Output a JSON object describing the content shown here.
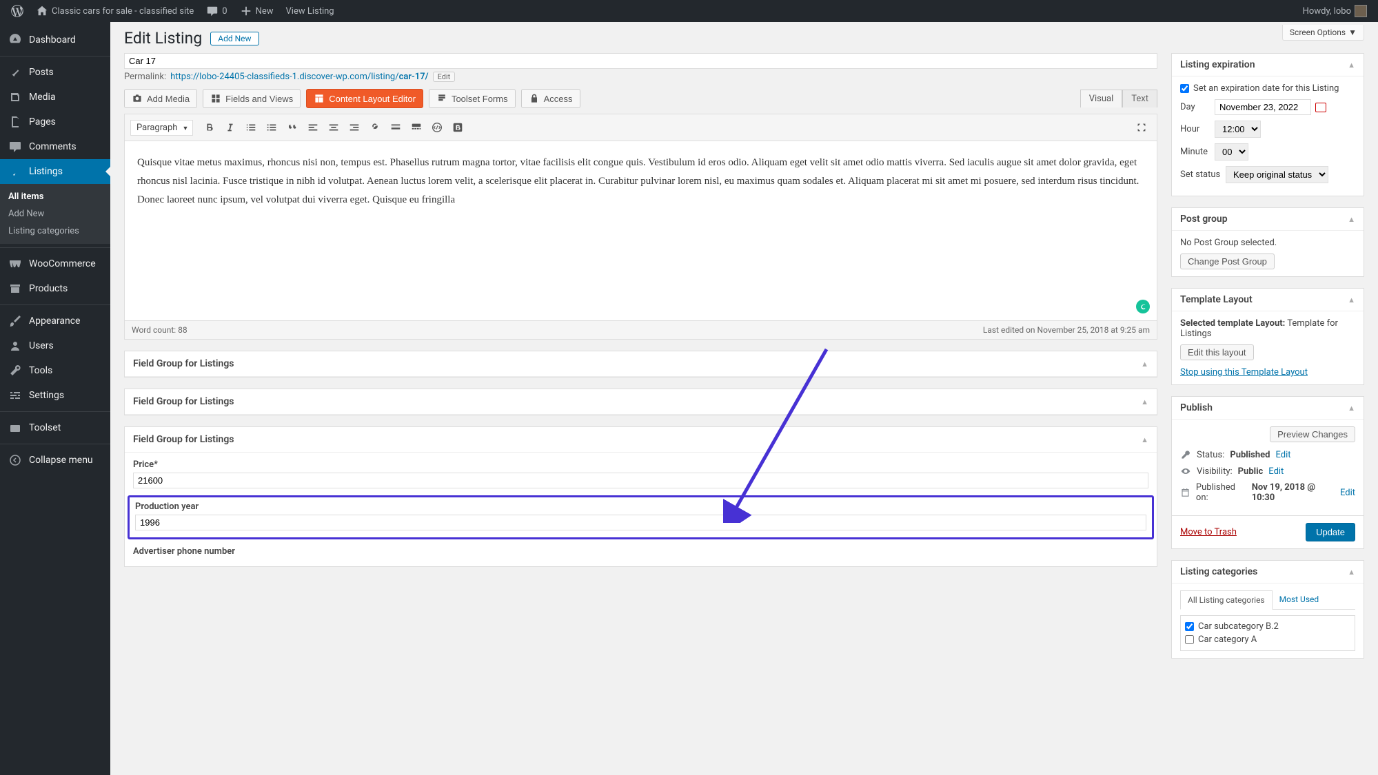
{
  "adminbar": {
    "site_name": "Classic cars for sale - classified site",
    "comments_count": "0",
    "new_label": "New",
    "view_listing": "View Listing",
    "howdy": "Howdy, lobo"
  },
  "sidebar": {
    "dashboard": "Dashboard",
    "posts": "Posts",
    "media": "Media",
    "pages": "Pages",
    "comments": "Comments",
    "listings": "Listings",
    "sub_all": "All items",
    "sub_add": "Add New",
    "sub_cats": "Listing categories",
    "woocommerce": "WooCommerce",
    "products": "Products",
    "appearance": "Appearance",
    "users": "Users",
    "tools": "Tools",
    "settings": "Settings",
    "toolset": "Toolset",
    "collapse": "Collapse menu"
  },
  "header": {
    "title": "Edit Listing",
    "add_new": "Add New",
    "screen_options": "Screen Options"
  },
  "title_input": "Car 17",
  "permalink": {
    "label": "Permalink:",
    "base": "https://lobo-24405-classifieds-1.discover-wp.com/listing/",
    "slug": "car-17/",
    "edit": "Edit"
  },
  "editor_buttons": {
    "add_media": "Add Media",
    "fields_views": "Fields and Views",
    "content_layout": "Content Layout Editor",
    "toolset_forms": "Toolset Forms",
    "access": "Access",
    "tab_visual": "Visual",
    "tab_text": "Text",
    "paragraph": "Paragraph"
  },
  "editor_body": "Quisque vitae metus maximus, rhoncus nisi non, tempus est. Phasellus rutrum magna tortor, vitae facilisis elit congue quis. Vestibulum id eros odio. Aliquam eget velit sit amet odio mattis viverra. Sed iaculis augue sit amet dolor gravida, eget rhoncus nisl lacinia. Fusce tristique in nibh id volutpat. Aenean luctus lorem velit, a scelerisque elit placerat in. Curabitur pulvinar lorem nisl, eu maximus quam sodales et. Aliquam placerat mi sit amet mi posuere, sed interdum risus tincidunt. Donec laoreet nunc ipsum, vel volutpat dui viverra eget. Quisque eu fringilla",
  "editor_footer": {
    "wordcount": "Word count: 88",
    "last_edit": "Last edited on November 25, 2018 at 9:25 am"
  },
  "metabox": {
    "field_group": "Field Group for Listings",
    "price_label": "Price*",
    "price_value": "21600",
    "year_label": "Production year",
    "year_value": "1996",
    "phone_label": "Advertiser phone number"
  },
  "side": {
    "expiration": {
      "title": "Listing expiration",
      "set_label": "Set an expiration date for this Listing",
      "day_label": "Day",
      "day_value": "November 23, 2022",
      "hour_label": "Hour",
      "hour_value": "12:00",
      "minute_label": "Minute",
      "minute_value": "00",
      "status_label": "Set status",
      "status_value": "Keep original status"
    },
    "postgroup": {
      "title": "Post group",
      "none": "No Post Group selected.",
      "change": "Change Post Group"
    },
    "template": {
      "title": "Template Layout",
      "selected_label": "Selected template Layout:",
      "selected_value": "Template for Listings",
      "edit": "Edit this layout",
      "stop": "Stop using this Template Layout"
    },
    "publish": {
      "title": "Publish",
      "preview": "Preview Changes",
      "status_label": "Status:",
      "status_value": "Published",
      "visibility_label": "Visibility:",
      "visibility_value": "Public",
      "published_label": "Published on:",
      "published_value": "Nov 19, 2018 @ 10:30",
      "edit": "Edit",
      "trash": "Move to Trash",
      "update": "Update"
    },
    "categories": {
      "title": "Listing categories",
      "tab_all": "All Listing categories",
      "tab_most": "Most Used",
      "cat1": "Car subcategory B.2",
      "cat2": "Car category A"
    }
  }
}
